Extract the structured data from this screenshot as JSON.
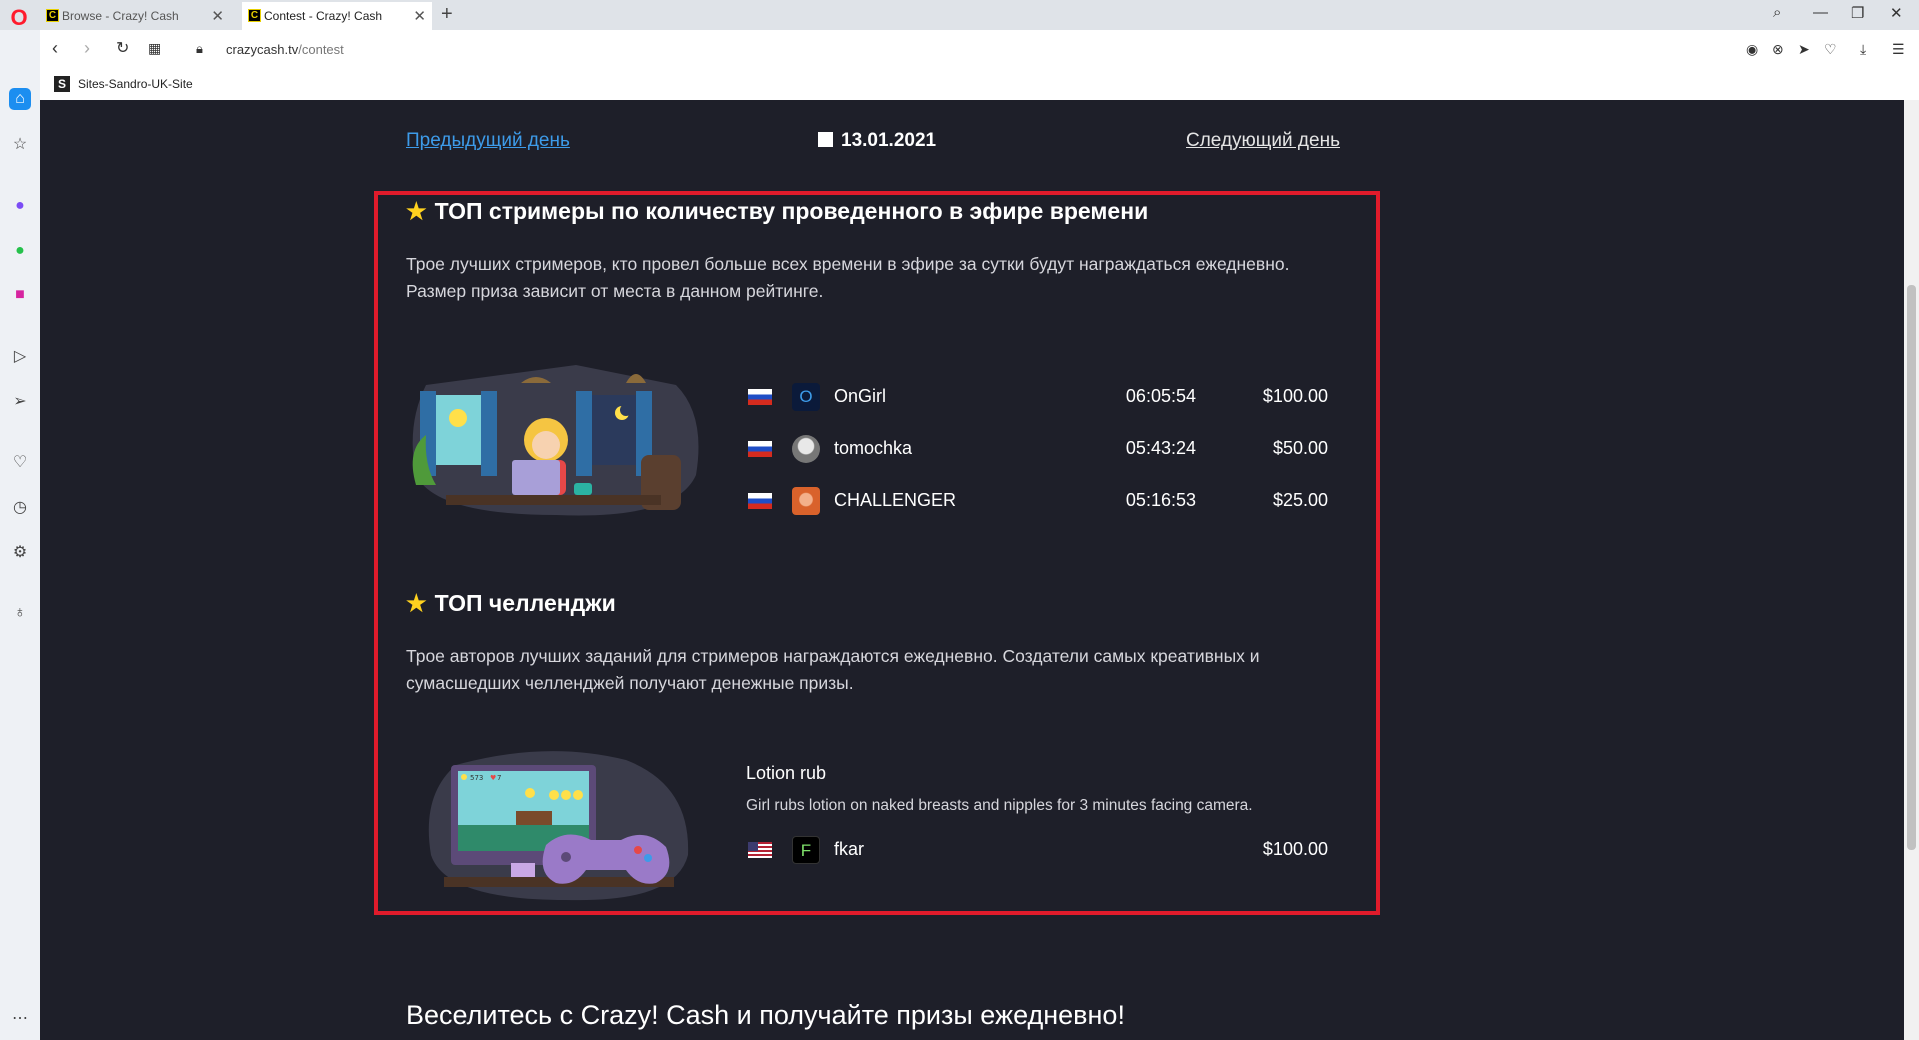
{
  "browser": {
    "tabs": [
      {
        "title": "Browse - Crazy! Cash",
        "active": false
      },
      {
        "title": "Contest - Crazy! Cash",
        "active": true
      }
    ],
    "url_host": "crazycash.tv",
    "url_path": "/contest",
    "bookmark": "Sites-Sandro-UK-Site"
  },
  "nav": {
    "prev_day": "Предыдущий день",
    "date": "13.01.2021",
    "next_day": "Следующий день"
  },
  "streamers": {
    "title": "ТОП стримеры по количеству проведенного в эфире времени",
    "desc_line1": "Трое лучших стримеров, кто провел больше всех времени в эфире за сутки будут награждаться ежедневно.",
    "desc_line2": "Размер приза зависит от места в данном рейтинге.",
    "rows": [
      {
        "flag": "ru",
        "avatar": "O",
        "name": "OnGirl",
        "time": "06:05:54",
        "prize": "$100.00"
      },
      {
        "flag": "ru",
        "avatar": "",
        "name": "tomochka",
        "time": "05:43:24",
        "prize": "$50.00"
      },
      {
        "flag": "ru",
        "avatar": "",
        "name": "CHALLENGER",
        "time": "05:16:53",
        "prize": "$25.00"
      }
    ]
  },
  "challenges": {
    "title": "ТОП челленджи",
    "desc_line1": "Трое авторов лучших заданий для стримеров награждаются ежедневно. Создатели самых креативных и",
    "desc_line2": "сумасшедших челленджей получают денежные призы.",
    "item": {
      "title": "Lotion rub",
      "desc": "Girl rubs lotion on naked breasts and nipples for 3 minutes facing camera.",
      "flag": "us",
      "avatar": "F",
      "name": "fkar",
      "prize": "$100.00"
    },
    "game_coins": "573",
    "game_lives": "7"
  },
  "footer": {
    "title": "Веселитесь с Crazy! Cash и получайте призы ежедневно!"
  },
  "colors": {
    "page_bg": "#1e1f29",
    "highlight": "#e01b2b",
    "star": "#ffd21f",
    "link": "#3d9be9"
  }
}
